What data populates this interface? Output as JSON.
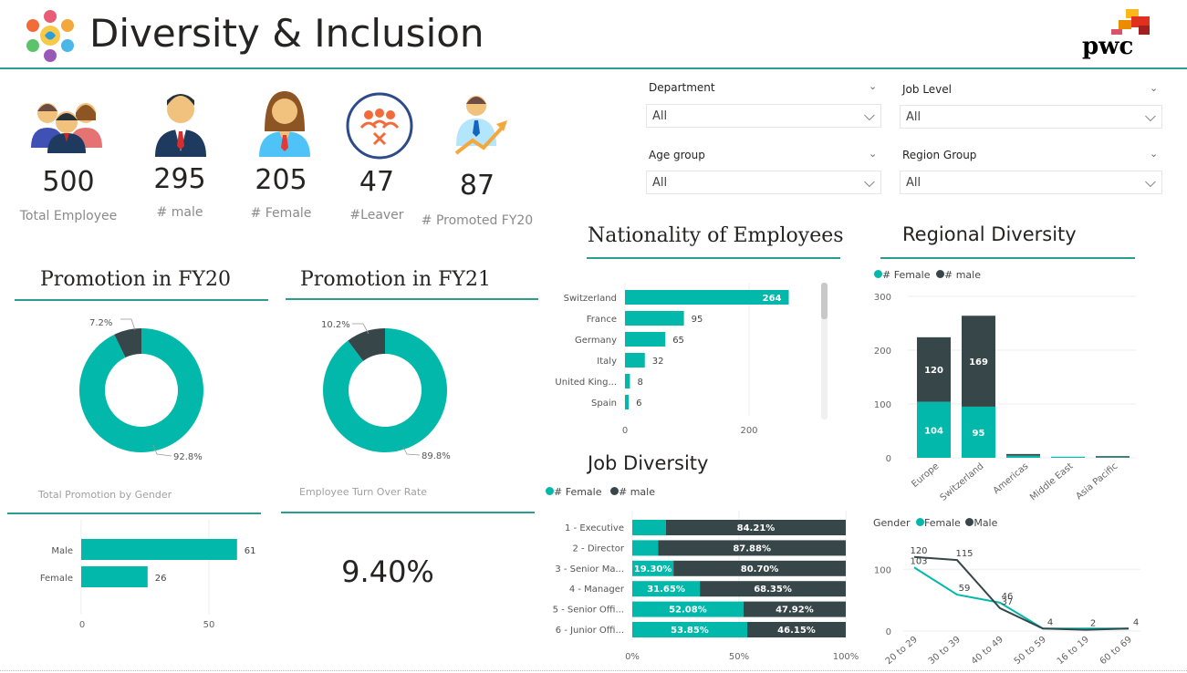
{
  "header": {
    "title": "Diversity & Inclusion",
    "brand": "pwc"
  },
  "kpis": [
    {
      "value": "500",
      "label": "Total Employee",
      "icon": "team-icon"
    },
    {
      "value": "295",
      "label": "# male",
      "icon": "male-icon"
    },
    {
      "value": "205",
      "label": "# Female",
      "icon": "female-icon"
    },
    {
      "value": "47",
      "label": "#Leaver",
      "icon": "leaver-icon"
    },
    {
      "value": "87",
      "label": "# Promoted FY20",
      "icon": "promoted-icon"
    }
  ],
  "slicers": [
    {
      "label": "Department",
      "value": "All"
    },
    {
      "label": "Job Level",
      "value": "All"
    },
    {
      "label": "Age group",
      "value": "All"
    },
    {
      "label": "Region Group",
      "value": "All"
    }
  ],
  "promo_fy20": {
    "title": "Promotion in FY20",
    "small": "7.2%",
    "large": "92.8%"
  },
  "promo_fy21": {
    "title": "Promotion in FY21",
    "small": "10.2%",
    "large": "89.8%"
  },
  "gender_promo": {
    "title": "Total Promotion by Gender",
    "axis": [
      "0",
      "50"
    ]
  },
  "turnover": {
    "title": "Employee Turn Over Rate",
    "value": "9.40%"
  },
  "nationality": {
    "title": "Nationality of Employees",
    "axis": [
      "0",
      "200"
    ]
  },
  "job": {
    "title": "Job Diversity",
    "legend": [
      "# Female",
      "# male"
    ],
    "axis": [
      "0%",
      "50%",
      "100%"
    ]
  },
  "regional": {
    "title": "Regional Diversity",
    "legend": [
      "# Female",
      "# male"
    ]
  },
  "age": {
    "legend_title": "Gender",
    "legend": [
      "Female",
      "Male"
    ]
  },
  "colors": {
    "teal": "#01b8aa",
    "dark": "#374649",
    "accent": "#2a9d8f"
  },
  "chart_data": [
    {
      "type": "bar",
      "title": "Total Promotion by Gender",
      "categories": [
        "Male",
        "Female"
      ],
      "values": [
        61,
        26
      ],
      "xlim": [
        0,
        70
      ]
    },
    {
      "type": "bar",
      "title": "Nationality of Employees",
      "categories": [
        "Switzerland",
        "France",
        "Germany",
        "Italy",
        "United King...",
        "Spain"
      ],
      "values": [
        264,
        95,
        65,
        32,
        8,
        6
      ],
      "xlim": [
        0,
        300
      ]
    },
    {
      "type": "bar",
      "title": "Job Diversity",
      "stacked": "100%",
      "categories": [
        "1 - Executive",
        "2 - Director",
        "3 - Senior Ma...",
        "4 - Manager",
        "5 - Senior Offi...",
        "6 - Junior Offi..."
      ],
      "series": [
        {
          "name": "# Female",
          "values": [
            15.79,
            12.12,
            19.3,
            31.65,
            52.08,
            53.85
          ],
          "labels": [
            "",
            "",
            "19.30%",
            "31.65%",
            "52.08%",
            "53.85%"
          ]
        },
        {
          "name": "# male",
          "values": [
            84.21,
            87.88,
            80.7,
            68.35,
            47.92,
            46.15
          ],
          "labels": [
            "84.21%",
            "87.88%",
            "80.70%",
            "68.35%",
            "47.92%",
            "46.15%"
          ]
        }
      ]
    },
    {
      "type": "bar",
      "title": "Regional Diversity",
      "stacked": true,
      "categories": [
        "Europe",
        "Switzerland",
        "Americas",
        "Middle East",
        "Asia Pacific"
      ],
      "series": [
        {
          "name": "# Female",
          "values": [
            104,
            95,
            4,
            2,
            1
          ]
        },
        {
          "name": "# male",
          "values": [
            120,
            169,
            3,
            0,
            2
          ]
        }
      ],
      "ylim": [
        0,
        300
      ],
      "yticks": [
        0,
        100,
        200,
        300
      ]
    },
    {
      "type": "line",
      "categories": [
        "20 to 29",
        "30 to 39",
        "40 to 49",
        "50 to 59",
        "16 to 19",
        "60 to 69"
      ],
      "series": [
        {
          "name": "Female",
          "values": [
            103,
            59,
            46,
            4,
            4,
            4
          ]
        },
        {
          "name": "Male",
          "values": [
            120,
            115,
            37,
            4,
            2,
            4
          ]
        }
      ],
      "labels": [
        {
          "text": "120",
          "cat": 0,
          "val": 120
        },
        {
          "text": "103",
          "cat": 0,
          "val": 103
        },
        {
          "text": "115",
          "cat": 1,
          "val": 115
        },
        {
          "text": "59",
          "cat": 1,
          "val": 59
        },
        {
          "text": "37",
          "cat": 2,
          "val": 37
        },
        {
          "text": "46",
          "cat": 2,
          "val": 46
        },
        {
          "text": "4",
          "cat": 3,
          "val": 4
        },
        {
          "text": "2",
          "cat": 4,
          "val": 2
        },
        {
          "text": "4",
          "cat": 5,
          "val": 4
        }
      ],
      "yticks": [
        0,
        100
      ],
      "ylim": [
        0,
        130
      ]
    },
    {
      "type": "pie",
      "title": "Promotion in FY20",
      "values": [
        92.8,
        7.2
      ]
    },
    {
      "type": "pie",
      "title": "Promotion in FY21",
      "values": [
        89.8,
        10.2
      ]
    }
  ]
}
